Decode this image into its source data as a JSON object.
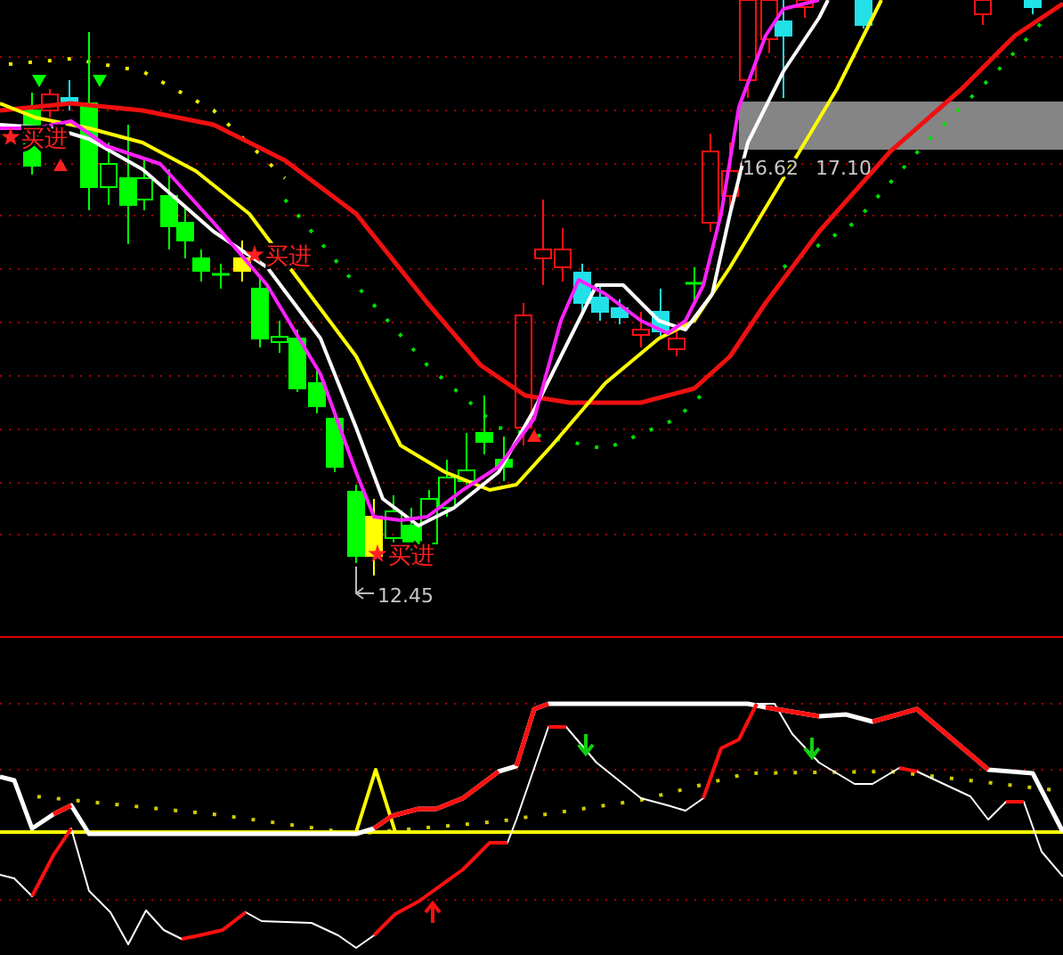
{
  "main_panel": {
    "buy_signals": [
      {
        "label": "买进"
      },
      {
        "label": "买进"
      },
      {
        "label": "买进"
      }
    ],
    "low_marker": {
      "label": "12.45"
    },
    "range_box": {
      "low": "16.62",
      "high": "17.10"
    }
  }
}
